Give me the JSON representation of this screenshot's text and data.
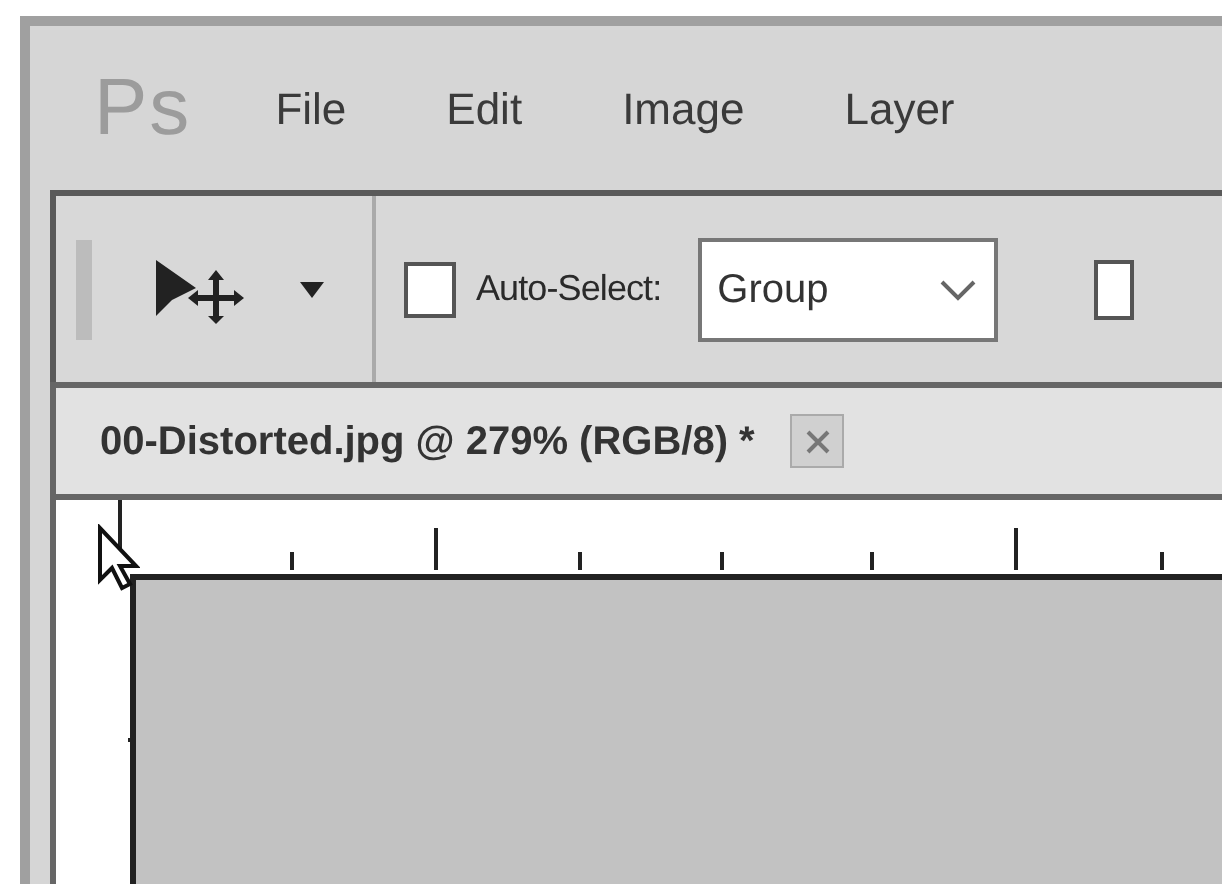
{
  "logo": "Ps",
  "menu": [
    {
      "label": "File"
    },
    {
      "label": "Edit"
    },
    {
      "label": "Image"
    },
    {
      "label": "Layer"
    }
  ],
  "toolbar": {
    "auto_select": {
      "label": "Auto-Select:",
      "checked": false
    },
    "dropdown": {
      "value": "Group"
    },
    "checkbox": {
      "checked": false
    }
  },
  "document_tab": {
    "title": "00-Distorted.jpg @ 279% (RGB/8) *"
  }
}
